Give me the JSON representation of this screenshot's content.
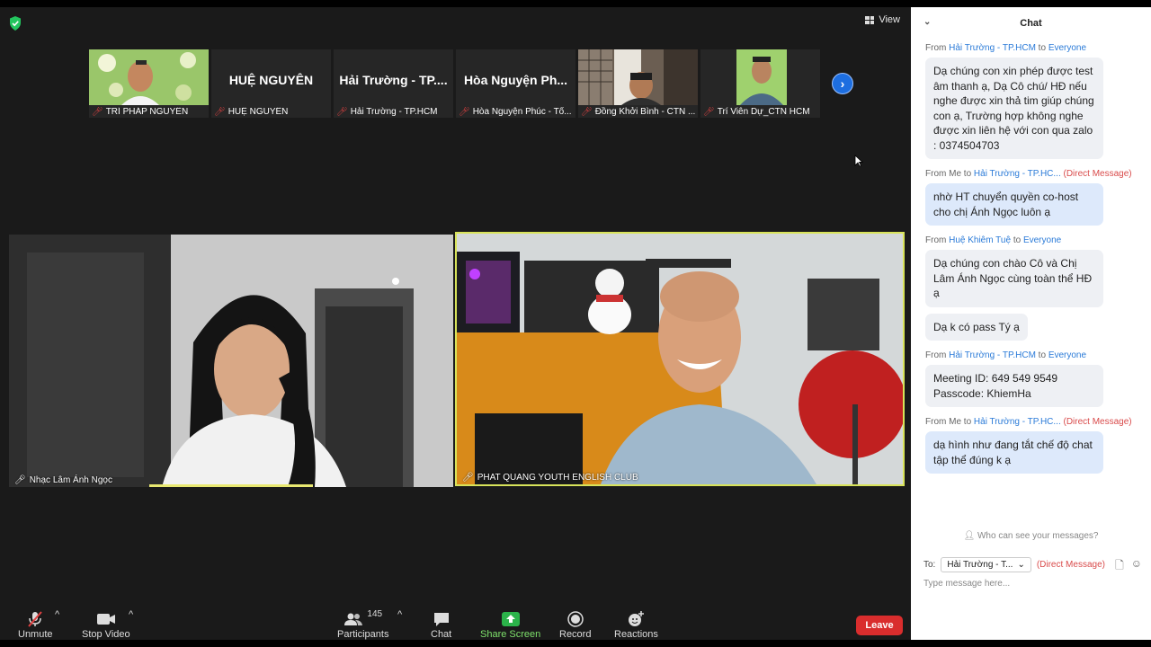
{
  "top": {
    "view_label": "View"
  },
  "participants_strip": [
    {
      "name": "TRÍ PHÁP NGUYÊN",
      "display": "",
      "has_video": true
    },
    {
      "name": "HUỆ NGUYÊN",
      "display": "HUỆ NGUYÊN",
      "has_video": false
    },
    {
      "name": "Hải Trường - TP.HCM",
      "display": "Hải Trường - TP....",
      "has_video": false
    },
    {
      "name": "Hòa Nguyện Phúc - Tổ...",
      "display": "Hòa Nguyện Ph...",
      "has_video": false
    },
    {
      "name": "Đồng Khởi Bình - CTN ...",
      "display": "",
      "has_video": true
    },
    {
      "name": "Trí Viên Dự_CTN HCM",
      "display": "",
      "has_video": true
    }
  ],
  "main_videos": [
    {
      "name": "Nhạc Lâm Ánh Ngọc"
    },
    {
      "name": "PHAT QUANG YOUTH ENGLISH CLUB"
    }
  ],
  "toolbar": {
    "unmute": "Unmute",
    "stop_video": "Stop Video",
    "participants": "Participants",
    "participants_count": "145",
    "chat": "Chat",
    "share_screen": "Share Screen",
    "record": "Record",
    "reactions": "Reactions",
    "leave": "Leave"
  },
  "chat": {
    "title": "Chat",
    "messages": [
      {
        "from": "Hải Trường - TP.HCM",
        "to": "Everyone",
        "dm": "",
        "bubbles": [
          "Dạ chúng con xin phép được test âm thanh ạ, Dạ Cô chú/ HĐ nếu nghe được xin thả tim giúp chúng con ạ, Trường hợp không nghe được xin liên hệ với con qua zalo : 0374504703"
        ]
      },
      {
        "from": "Me",
        "to": "Hải Trường - TP.HC...",
        "dm": "(Direct Message)",
        "bubbles": [
          "nhờ HT chuyển quyền co-host cho chị Ánh Ngọc luôn ạ"
        ]
      },
      {
        "from": "Huệ Khiêm Tuệ",
        "to": "Everyone",
        "dm": "",
        "bubbles": [
          "Dạ chúng con chào Cô và Chị Lâm Ánh Ngọc cùng toàn thể HĐ ạ",
          "Dạ k có pass Tý ạ"
        ]
      },
      {
        "from": "Hải Trường - TP.HCM",
        "to": "Everyone",
        "dm": "",
        "bubbles": [
          "Meeting ID: 649 549 9549 Passcode: KhiemHa"
        ]
      },
      {
        "from": "Me",
        "to": "Hải Trường - TP.HC...",
        "dm": "(Direct Message)",
        "bubbles": [
          "dạ hình như đang tắt chế độ chat tập thể đúng k ạ"
        ]
      }
    ],
    "who_can_see": "Who can see your messages?",
    "to_label": "To:",
    "to_value": "Hải Trường - T...",
    "to_dm": "(Direct Message)",
    "input_placeholder": "Type message here..."
  }
}
